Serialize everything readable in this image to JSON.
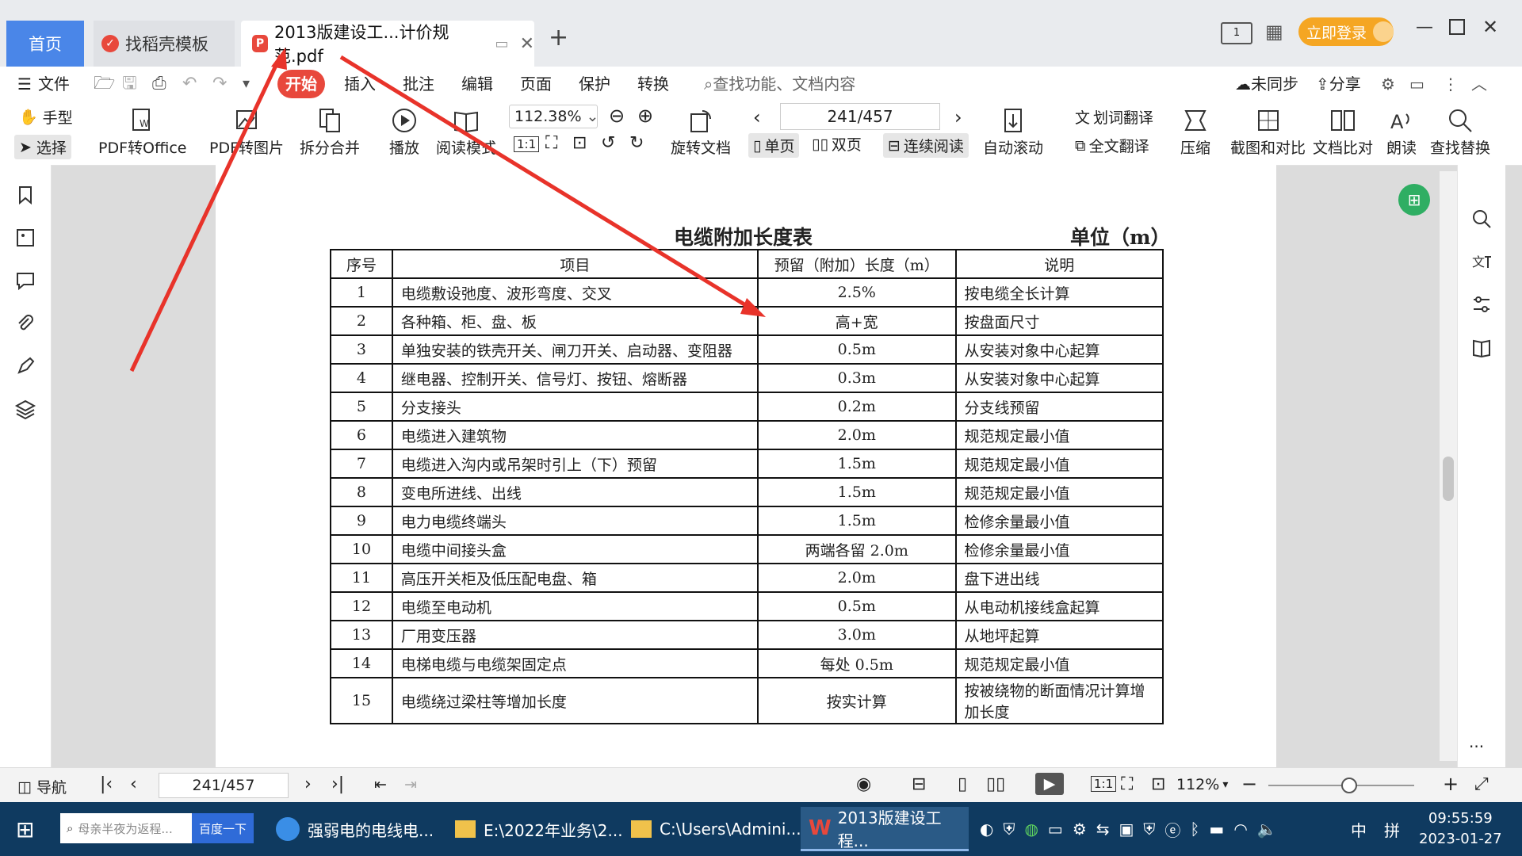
{
  "tabs": {
    "home": "首页",
    "template": "找稻壳模板",
    "document": "2013版建设工...计价规范.pdf",
    "login": "立即登录"
  },
  "menu": {
    "file": "文件",
    "items": [
      "开始",
      "插入",
      "批注",
      "编辑",
      "页面",
      "保护",
      "转换"
    ],
    "search_placeholder": "查找功能、文档内容",
    "sync": "未同步",
    "share": "分享"
  },
  "ribbon": {
    "hand": "手型",
    "select": "选择",
    "pdf_to_office": "PDF转Office",
    "pdf_to_image": "PDF转图片",
    "split_merge": "拆分合并",
    "play": "播放",
    "read_mode": "阅读模式",
    "zoom": "112.38%",
    "rotate": "旋转文档",
    "page_num": "241/457",
    "single": "单页",
    "double": "双页",
    "continuous": "连续阅读",
    "auto_scroll": "自动滚动",
    "word_translate": "划词翻译",
    "full_translate": "全文翻译",
    "compress": "压缩",
    "screenshot": "截图和对比",
    "compare": "文档比对",
    "read_aloud": "朗读",
    "find_replace": "查找替换"
  },
  "document": {
    "title": "电缆附加长度表",
    "unit": "单位（m）",
    "headers": [
      "序号",
      "项目",
      "预留（附加）长度（m）",
      "说明"
    ],
    "rows": [
      [
        "1",
        "电缆敷设弛度、波形弯度、交叉",
        "2.5%",
        "按电缆全长计算"
      ],
      [
        "2",
        "各种箱、柜、盘、板",
        "高+宽",
        "按盘面尺寸"
      ],
      [
        "3",
        "单独安装的铁壳开关、闸刀开关、启动器、变阻器",
        "0.5m",
        "从安装对象中心起算"
      ],
      [
        "4",
        "继电器、控制开关、信号灯、按钮、熔断器",
        "0.3m",
        "从安装对象中心起算"
      ],
      [
        "5",
        "分支接头",
        "0.2m",
        "分支线预留"
      ],
      [
        "6",
        "电缆进入建筑物",
        "2.0m",
        "规范规定最小值"
      ],
      [
        "7",
        "电缆进入沟内或吊架时引上（下）预留",
        "1.5m",
        "规范规定最小值"
      ],
      [
        "8",
        "变电所进线、出线",
        "1.5m",
        "规范规定最小值"
      ],
      [
        "9",
        "电力电缆终端头",
        "1.5m",
        "检修余量最小值"
      ],
      [
        "10",
        "电缆中间接头盒",
        "两端各留 2.0m",
        "检修余量最小值"
      ],
      [
        "11",
        "高压开关柜及低压配电盘、箱",
        "2.0m",
        "盘下进出线"
      ],
      [
        "12",
        "电缆至电动机",
        "0.5m",
        "从电动机接线盒起算"
      ],
      [
        "13",
        "厂用变压器",
        "3.0m",
        "从地坪起算"
      ],
      [
        "14",
        "电梯电缆与电缆架固定点",
        "每处 0.5m",
        "规范规定最小值"
      ],
      [
        "15",
        "电缆绕过梁柱等增加长度",
        "按实计算",
        "按被绕物的断面情况计算增加长度"
      ]
    ]
  },
  "statusbar": {
    "nav": "导航",
    "page": "241/457",
    "zoom": "112%"
  },
  "taskbar": {
    "search_placeholder": "母亲半夜为返程...",
    "search_button": "百度一下",
    "apps": [
      "强弱电的电线电...",
      "E:\\2022年业务\\2...",
      "C:\\Users\\Admini...",
      "2013版建设工程..."
    ],
    "ime": "中",
    "ime2": "拼",
    "time": "09:55:59",
    "date": "2023-01-27"
  },
  "colors": {
    "accent": "#4a86e8",
    "start_tab": "#e8483c",
    "taskbar": "#0f3a60",
    "arrow": "#e8332a"
  }
}
